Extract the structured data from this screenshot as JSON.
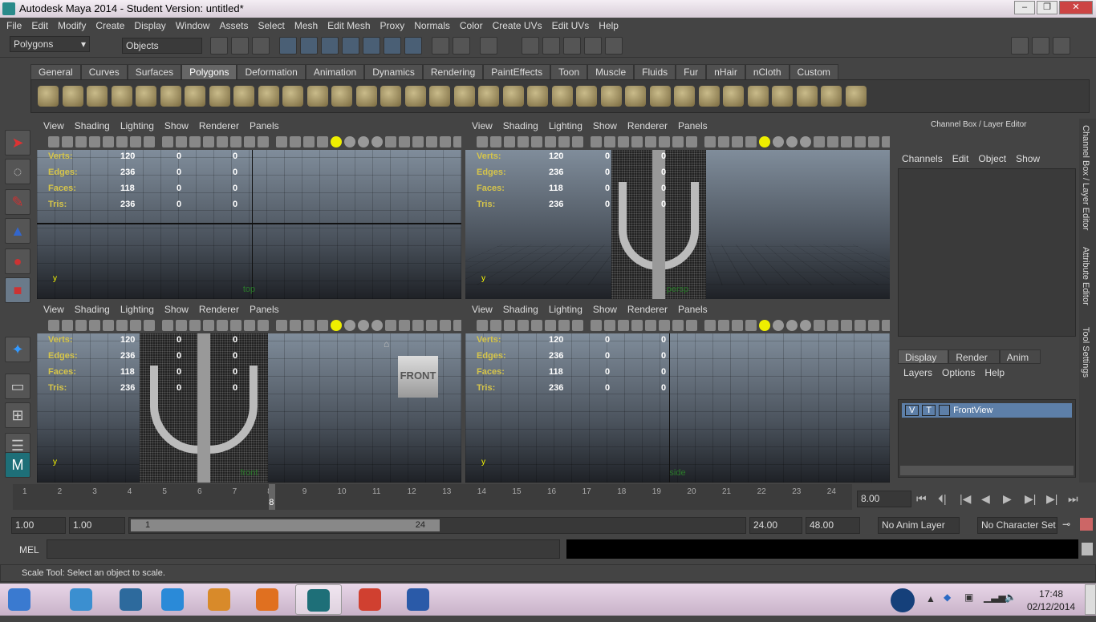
{
  "window": {
    "title": "Autodesk Maya 2014 - Student Version: untitled*",
    "minimize": "–",
    "maximize": "❐",
    "close": "✕"
  },
  "menu": [
    "File",
    "Edit",
    "Modify",
    "Create",
    "Display",
    "Window",
    "Assets",
    "Select",
    "Mesh",
    "Edit Mesh",
    "Proxy",
    "Normals",
    "Color",
    "Create UVs",
    "Edit UVs",
    "Help"
  ],
  "status": {
    "menuset": "Polygons",
    "selection_mode": "Objects"
  },
  "shelf": {
    "tabs": [
      "General",
      "Curves",
      "Surfaces",
      "Polygons",
      "Deformation",
      "Animation",
      "Dynamics",
      "Rendering",
      "PaintEffects",
      "Toon",
      "Muscle",
      "Fluids",
      "Fur",
      "nHair",
      "nCloth",
      "Custom"
    ],
    "active": "Polygons",
    "icon_count": 34
  },
  "toolbox": [
    "select-tool",
    "lasso-tool",
    "paint-select-tool",
    "move-tool",
    "rotate-tool",
    "scale-tool",
    "manipulator-tool",
    "quick-layout-single",
    "quick-layout-four",
    "outliner-layout",
    "maya-logo"
  ],
  "viewport": {
    "menu": [
      "View",
      "Shading",
      "Lighting",
      "Show",
      "Renderer",
      "Panels"
    ],
    "hud": [
      {
        "label": "Verts:",
        "values": [
          "120",
          "0",
          "0"
        ]
      },
      {
        "label": "Edges:",
        "values": [
          "236",
          "0",
          "0"
        ]
      },
      {
        "label": "Faces:",
        "values": [
          "118",
          "0",
          "0"
        ]
      },
      {
        "label": "Tris:",
        "values": [
          "236",
          "0",
          "0"
        ]
      }
    ],
    "panes": [
      {
        "name": "top"
      },
      {
        "name": "persp"
      },
      {
        "name": "front",
        "viewcube": "FRONT"
      },
      {
        "name": "side"
      }
    ],
    "axis_y": "y"
  },
  "channel_box": {
    "title": "Channel Box / Layer Editor",
    "menu": [
      "Channels",
      "Edit",
      "Object",
      "Show"
    ],
    "layer_tabs": [
      "Display",
      "Render",
      "Anim"
    ],
    "active_layer_tab": "Display",
    "layer_menu": [
      "Layers",
      "Options",
      "Help"
    ],
    "layer": {
      "v": "V",
      "t": "T",
      "name": "FrontView"
    }
  },
  "side_tabs": [
    "Channel Box / Layer Editor",
    "Attribute Editor",
    "Tool Settings"
  ],
  "time": {
    "ticks": [
      "1",
      "2",
      "3",
      "4",
      "5",
      "6",
      "7",
      "8",
      "9",
      "10",
      "11",
      "12",
      "13",
      "14",
      "15",
      "16",
      "17",
      "18",
      "19",
      "20",
      "21",
      "22",
      "23",
      "24"
    ],
    "current": "8",
    "current_field": "8.00"
  },
  "range": {
    "start": "1.00",
    "anim_start": "1.00",
    "slider_start": "1",
    "slider_end": "24",
    "end": "24.00",
    "anim_end": "48.00",
    "anim_layer": "No Anim Layer",
    "character_set": "No Character Set"
  },
  "command": {
    "label": "MEL",
    "value": ""
  },
  "helpline": "Scale Tool: Select an object to scale.",
  "taskbar": {
    "time": "17:48",
    "date": "02/12/2014",
    "apps": [
      "start",
      "screen-capture",
      "hp",
      "internet-explorer",
      "paint",
      "media-player",
      "maya",
      "chrome",
      "word"
    ]
  }
}
